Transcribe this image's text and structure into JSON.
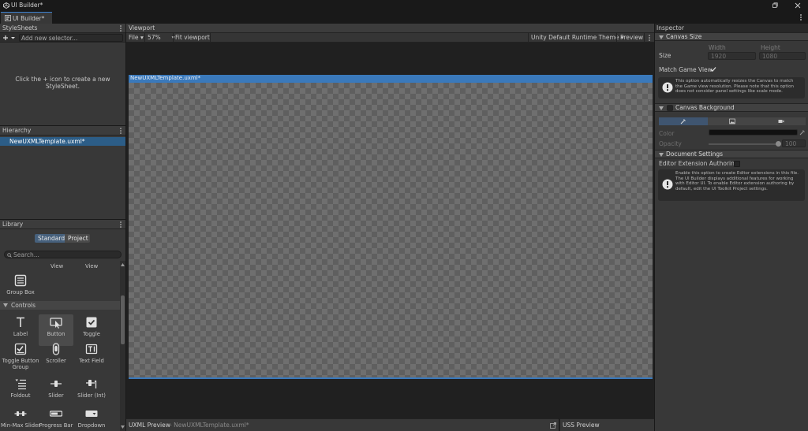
{
  "app": {
    "title": "UI Builder*",
    "tab": "UI Builder*"
  },
  "stylesheets": {
    "header": "StyleSheets",
    "add_label": "+",
    "selector_placeholder": "Add new selector...",
    "empty_message": "Click the + icon to create a new StyleSheet."
  },
  "hierarchy": {
    "header": "Hierarchy",
    "items": [
      "NewUXMLTemplate.uxml*"
    ]
  },
  "library": {
    "header": "Library",
    "tabs": [
      "Standard",
      "Project"
    ],
    "search_placeholder": "Search...",
    "top_partial": [
      "View",
      "View"
    ],
    "group_box": "Group Box",
    "section": "Controls",
    "items": [
      {
        "label": "Label",
        "icon": "label-icon"
      },
      {
        "label": "Button",
        "icon": "button-icon"
      },
      {
        "label": "Toggle",
        "icon": "toggle-icon"
      },
      {
        "label": "Toggle Button Group",
        "icon": "toggle-button-group-icon"
      },
      {
        "label": "Scroller",
        "icon": "scroller-icon"
      },
      {
        "label": "Text Field",
        "icon": "text-field-icon"
      },
      {
        "label": "Foldout",
        "icon": "foldout-icon"
      },
      {
        "label": "Slider",
        "icon": "slider-icon"
      },
      {
        "label": "Slider (Int)",
        "icon": "slider-int-icon"
      },
      {
        "label": "Min-Max Slider",
        "icon": "min-max-slider-icon"
      },
      {
        "label": "Progress Bar",
        "icon": "progress-bar-icon"
      },
      {
        "label": "Dropdown",
        "icon": "dropdown-icon"
      }
    ]
  },
  "viewport": {
    "header": "Viewport",
    "file_menu": "File",
    "zoom": "57%",
    "fit": "Fit viewport",
    "theme": "Unity Default Runtime Theme",
    "preview": "Preview",
    "canvas_title": "NewUXMLTemplate.uxml*"
  },
  "previews": {
    "uxml_label": "UXML Preview",
    "uxml_file": "- NewUXMLTemplate.uxml*",
    "uss_label": "USS Preview"
  },
  "inspector": {
    "header": "Inspector",
    "canvas_size": {
      "title": "Canvas Size",
      "size_label": "Size",
      "width_label": "Width",
      "height_label": "Height",
      "width": "1920",
      "height": "1080",
      "match_label": "Match Game View",
      "match_checked": true,
      "help": "This option automatically resizes the Canvas to match the Game view resolution. Please note that this option does not consider panel settings like scale mode."
    },
    "canvas_background": {
      "title": "Canvas Background",
      "color_label": "Color",
      "opacity_label": "Opacity",
      "opacity": "100",
      "color_value": "#111111"
    },
    "document_settings": {
      "title": "Document Settings",
      "editor_ext_label": "Editor Extension Authoring",
      "help": "Enable this option to create Editor extensions in this file. The UI Builder displays additional features for working with Editor UI. To enable Editor extension authoring by default, edit the UI Toolkit Project settings."
    }
  },
  "colors": {
    "accent": "#3a79bb",
    "selection": "#2c5d87",
    "panel": "#383838"
  }
}
